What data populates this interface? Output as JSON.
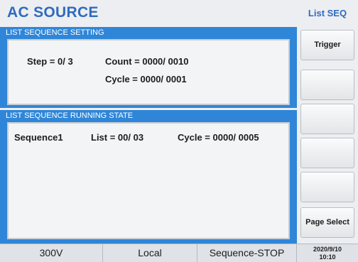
{
  "header": {
    "title": "AC SOURCE"
  },
  "sidebar": {
    "title": "List SEQ",
    "buttons": [
      {
        "label": "Trigger"
      },
      {
        "label": ""
      },
      {
        "label": ""
      },
      {
        "label": ""
      },
      {
        "label": ""
      },
      {
        "label": "Page Select"
      }
    ]
  },
  "setting": {
    "section_title": "LIST SEQUENCE SETTING",
    "step": "Step = 0/ 3",
    "count": "Count = 0000/ 0010",
    "cycle": "Cycle = 0000/ 0001"
  },
  "running": {
    "section_title": "LIST SEQUENCE RUNNING STATE",
    "sequence": "Sequence1",
    "list": "List = 00/ 03",
    "cycle": "Cycle = 0000/ 0005"
  },
  "status": {
    "voltage": "300V",
    "mode": "Local",
    "state": "Sequence-STOP",
    "date": "2020/9/10",
    "time": "10:10"
  }
}
